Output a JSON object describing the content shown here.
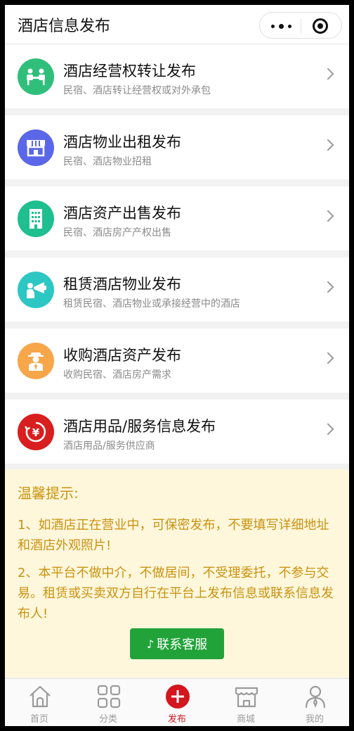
{
  "header": {
    "title": "酒店信息发布",
    "more_icon": "more-dots-icon",
    "close_icon": "target-circle-icon"
  },
  "items": [
    {
      "title": "酒店经营权转让发布",
      "subtitle": "民宿、酒店转让经营权或对外承包",
      "icon": "transfer-people-icon",
      "color": "#2fbf7a"
    },
    {
      "title": "酒店物业出租发布",
      "subtitle": "民宿、酒店物业招租",
      "icon": "storefront-icon",
      "color": "#5a67e8"
    },
    {
      "title": "酒店资产出售发布",
      "subtitle": "民宿、酒店房产产权出售",
      "icon": "building-icon",
      "color": "#1fbf8f"
    },
    {
      "title": "租赁酒店物业发布",
      "subtitle": "租赁民宿、酒店物业或承接经营中的酒店",
      "icon": "megaphone-person-icon",
      "color": "#2cc7c3"
    },
    {
      "title": "收购酒店资产发布",
      "subtitle": "收购民宿、酒店房产需求",
      "icon": "businessman-icon",
      "color": "#f7a64a"
    },
    {
      "title": "酒店用品/服务信息发布",
      "subtitle": "酒店用品/服务供应商",
      "icon": "yen-coin-icon",
      "color": "#d81e1e"
    }
  ],
  "tip": {
    "title": "温馨提示:",
    "line1": "1、如酒店正在营业中，可保密发布，不要填写详细地址和酒店外观照片!",
    "line2": "2、本平台不做中介，不做居间，不受理委托，不参与交易。租赁或买卖双方自行在平台上发布信息或联系信息发布人!"
  },
  "contact_button": {
    "label": "联系客服",
    "icon": "phone-icon"
  },
  "tabbar": [
    {
      "label": "首页",
      "icon": "home-icon",
      "active": false
    },
    {
      "label": "分类",
      "icon": "grid-icon",
      "active": false
    },
    {
      "label": "发布",
      "icon": "plus-circle-icon",
      "active": true
    },
    {
      "label": "商城",
      "icon": "shop-icon",
      "active": false
    },
    {
      "label": "我的",
      "icon": "user-icon",
      "active": false
    }
  ],
  "colors": {
    "accent_red": "#d4161e",
    "tip_text": "#c9920f",
    "tip_bg": "#fff7dc",
    "button_green": "#22a33a"
  }
}
